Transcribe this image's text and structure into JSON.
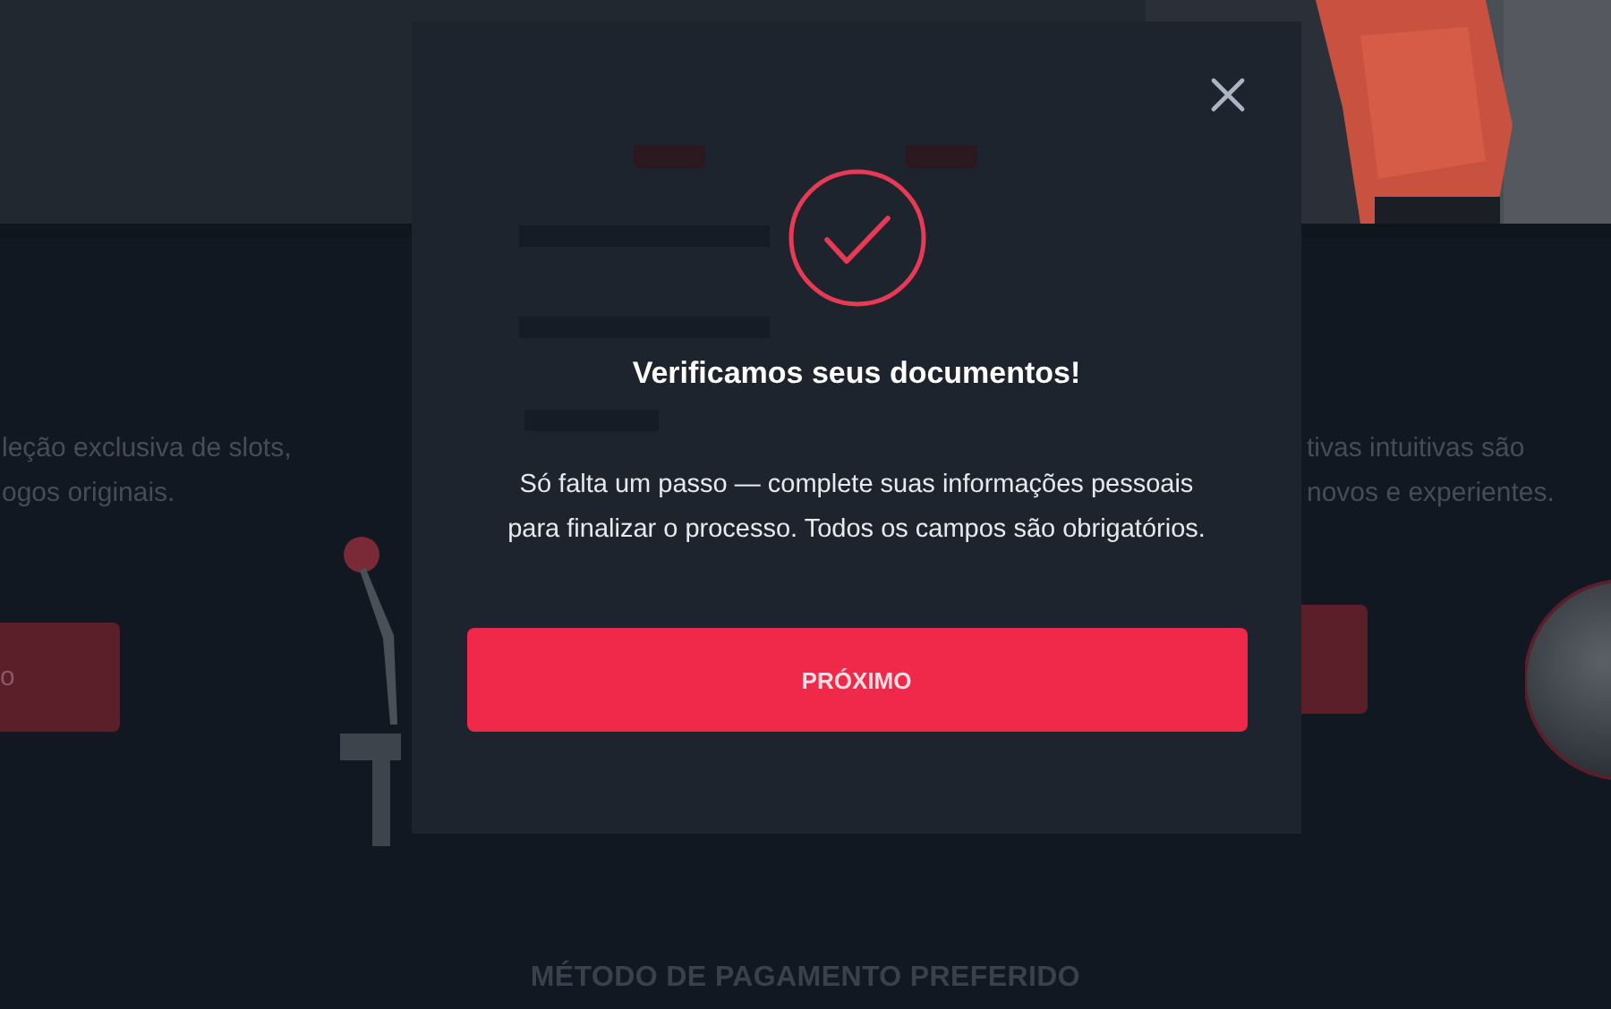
{
  "background": {
    "left_card": {
      "text_lines": [
        "leção exclusiva de slots,",
        "ogos originais."
      ],
      "button": "o"
    },
    "right_card": {
      "text_lines": [
        "tivas intuitivas são",
        "novos e experientes."
      ]
    },
    "section_heading": "MÉTODO DE PAGAMENTO PREFERIDO"
  },
  "dialog": {
    "title": "Verificamos seus documentos!",
    "message": "Só falta um passo — complete suas informações pessoais para finalizar o processo. Todos os campos são obrigatórios.",
    "button": "PRÓXIMO"
  }
}
